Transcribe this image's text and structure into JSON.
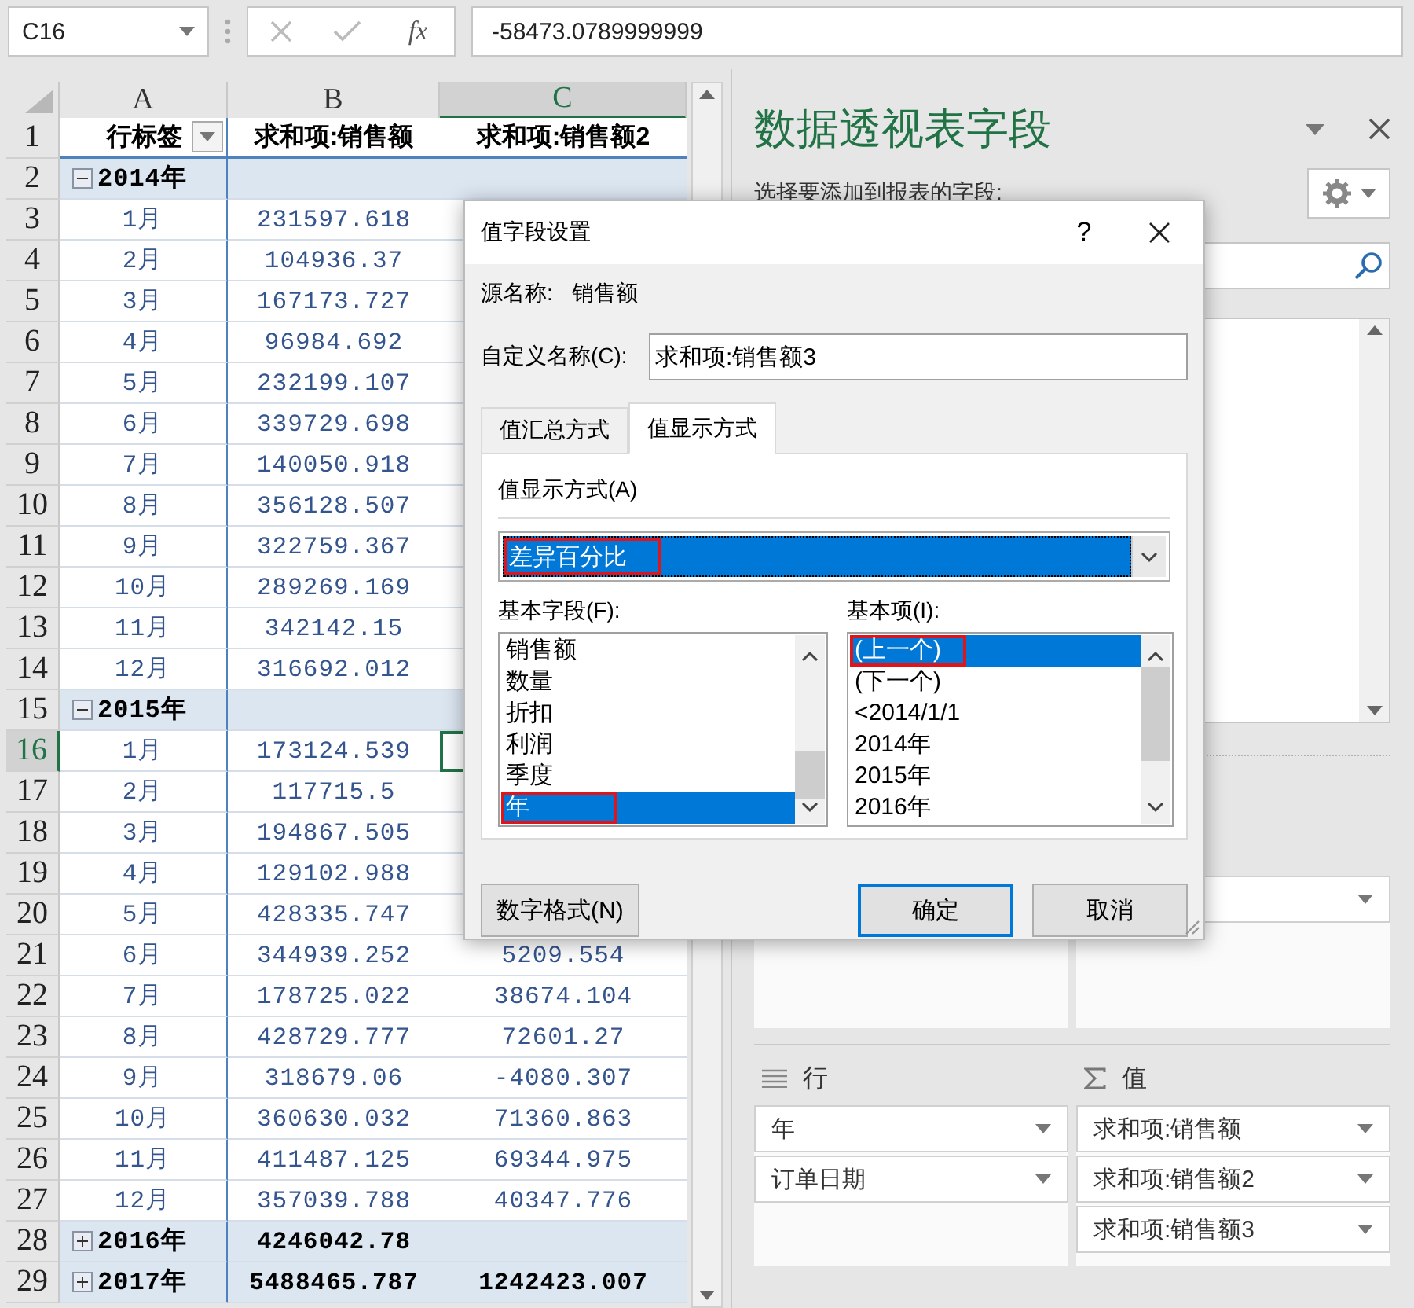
{
  "formula_bar": {
    "name_box": "C16",
    "function_label": "fx",
    "value": "-58473.0789999999"
  },
  "sheet": {
    "columns": [
      {
        "label": "A",
        "selected": false
      },
      {
        "label": "B",
        "selected": false
      },
      {
        "label": "C",
        "selected": true
      }
    ],
    "rows": [
      {
        "num": "1",
        "kind": "header",
        "selected": false,
        "a": "行标签",
        "b": "求和项:销售额",
        "c": "求和项:销售额2"
      },
      {
        "num": "2",
        "kind": "group",
        "selected": false,
        "expanded": true,
        "a": "2014年"
      },
      {
        "num": "3",
        "kind": "item",
        "selected": false,
        "a": "1月",
        "b": "231597.618"
      },
      {
        "num": "4",
        "kind": "item",
        "selected": false,
        "a": "2月",
        "b": "104936.37"
      },
      {
        "num": "5",
        "kind": "item",
        "selected": false,
        "a": "3月",
        "b": "167173.727"
      },
      {
        "num": "6",
        "kind": "item",
        "selected": false,
        "a": "4月",
        "b": "96984.692"
      },
      {
        "num": "7",
        "kind": "item",
        "selected": false,
        "a": "5月",
        "b": "232199.107"
      },
      {
        "num": "8",
        "kind": "item",
        "selected": false,
        "a": "6月",
        "b": "339729.698"
      },
      {
        "num": "9",
        "kind": "item",
        "selected": false,
        "a": "7月",
        "b": "140050.918"
      },
      {
        "num": "10",
        "kind": "item",
        "selected": false,
        "a": "8月",
        "b": "356128.507"
      },
      {
        "num": "11",
        "kind": "item",
        "selected": false,
        "a": "9月",
        "b": "322759.367"
      },
      {
        "num": "12",
        "kind": "item",
        "selected": false,
        "a": "10月",
        "b": "289269.169"
      },
      {
        "num": "13",
        "kind": "item",
        "selected": false,
        "a": "11月",
        "b": "342142.15"
      },
      {
        "num": "14",
        "kind": "item",
        "selected": false,
        "a": "12月",
        "b": "316692.012"
      },
      {
        "num": "15",
        "kind": "group",
        "selected": false,
        "expanded": true,
        "a": "2015年"
      },
      {
        "num": "16",
        "kind": "item",
        "selected": true,
        "a": "1月",
        "b": "173124.539"
      },
      {
        "num": "17",
        "kind": "item",
        "selected": false,
        "a": "2月",
        "b": "117715.5"
      },
      {
        "num": "18",
        "kind": "item",
        "selected": false,
        "a": "3月",
        "b": "194867.505"
      },
      {
        "num": "19",
        "kind": "item",
        "selected": false,
        "a": "4月",
        "b": "129102.988"
      },
      {
        "num": "20",
        "kind": "item",
        "selected": false,
        "a": "5月",
        "b": "428335.747"
      },
      {
        "num": "21",
        "kind": "item",
        "selected": false,
        "a": "6月",
        "b": "344939.252",
        "c": "5209.554"
      },
      {
        "num": "22",
        "kind": "item",
        "selected": false,
        "a": "7月",
        "b": "178725.022",
        "c": "38674.104"
      },
      {
        "num": "23",
        "kind": "item",
        "selected": false,
        "a": "8月",
        "b": "428729.777",
        "c": "72601.27"
      },
      {
        "num": "24",
        "kind": "item",
        "selected": false,
        "a": "9月",
        "b": "318679.06",
        "c": "-4080.307"
      },
      {
        "num": "25",
        "kind": "item",
        "selected": false,
        "a": "10月",
        "b": "360630.032",
        "c": "71360.863"
      },
      {
        "num": "26",
        "kind": "item",
        "selected": false,
        "a": "11月",
        "b": "411487.125",
        "c": "69344.975"
      },
      {
        "num": "27",
        "kind": "item",
        "selected": false,
        "a": "12月",
        "b": "357039.788",
        "c": "40347.776"
      },
      {
        "num": "28",
        "kind": "group",
        "selected": false,
        "expanded": false,
        "a": "2016年",
        "b": "4246042.78"
      },
      {
        "num": "29",
        "kind": "group",
        "selected": false,
        "expanded": false,
        "a": "2017年",
        "b": "5488465.787",
        "c": "1242423.007"
      }
    ]
  },
  "pane": {
    "title": "数据透视表字段",
    "subtitle": "选择要添加到报表的字段:",
    "areas": [
      {
        "kind": "rows",
        "label": "行",
        "items": [
          "年",
          "订单日期"
        ]
      },
      {
        "kind": "values",
        "label": "值",
        "items": [
          "求和项:销售额",
          "求和项:销售额2",
          "求和项:销售额3"
        ]
      }
    ]
  },
  "dialog": {
    "title": "值字段设置",
    "help": "?",
    "source_label": "源名称:",
    "source_value": "销售额",
    "custom_name_label": "自定义名称(C):",
    "custom_name": "求和项:销售额3",
    "tabs": [
      {
        "label": "值汇总方式",
        "selected": false
      },
      {
        "label": "值显示方式",
        "selected": true
      }
    ],
    "show_as_label": "值显示方式(A)",
    "show_as": {
      "value": "差异百分比",
      "annotated": true
    },
    "base_field": {
      "label": "基本字段(F):",
      "items": [
        {
          "text": "销售额",
          "selected": false,
          "annotated": false
        },
        {
          "text": "数量",
          "selected": false,
          "annotated": false
        },
        {
          "text": "折扣",
          "selected": false,
          "annotated": false
        },
        {
          "text": "利润",
          "selected": false,
          "annotated": false
        },
        {
          "text": "季度",
          "selected": false,
          "annotated": false
        },
        {
          "text": "年",
          "selected": true,
          "annotated": true
        }
      ]
    },
    "base_item": {
      "label": "基本项(I):",
      "items": [
        {
          "text": "(上一个)",
          "selected": true,
          "annotated": true
        },
        {
          "text": "(下一个)",
          "selected": false,
          "annotated": false
        },
        {
          "text": "<2014/1/1",
          "selected": false,
          "annotated": false
        },
        {
          "text": "2014年",
          "selected": false,
          "annotated": false
        },
        {
          "text": "2015年",
          "selected": false,
          "annotated": false
        },
        {
          "text": "2016年",
          "selected": false,
          "annotated": false
        }
      ]
    },
    "buttons": [
      {
        "label": "数字格式(N)",
        "kind": "normal"
      },
      {
        "label": "确定",
        "kind": "default"
      },
      {
        "label": "取消",
        "kind": "normal"
      }
    ]
  }
}
